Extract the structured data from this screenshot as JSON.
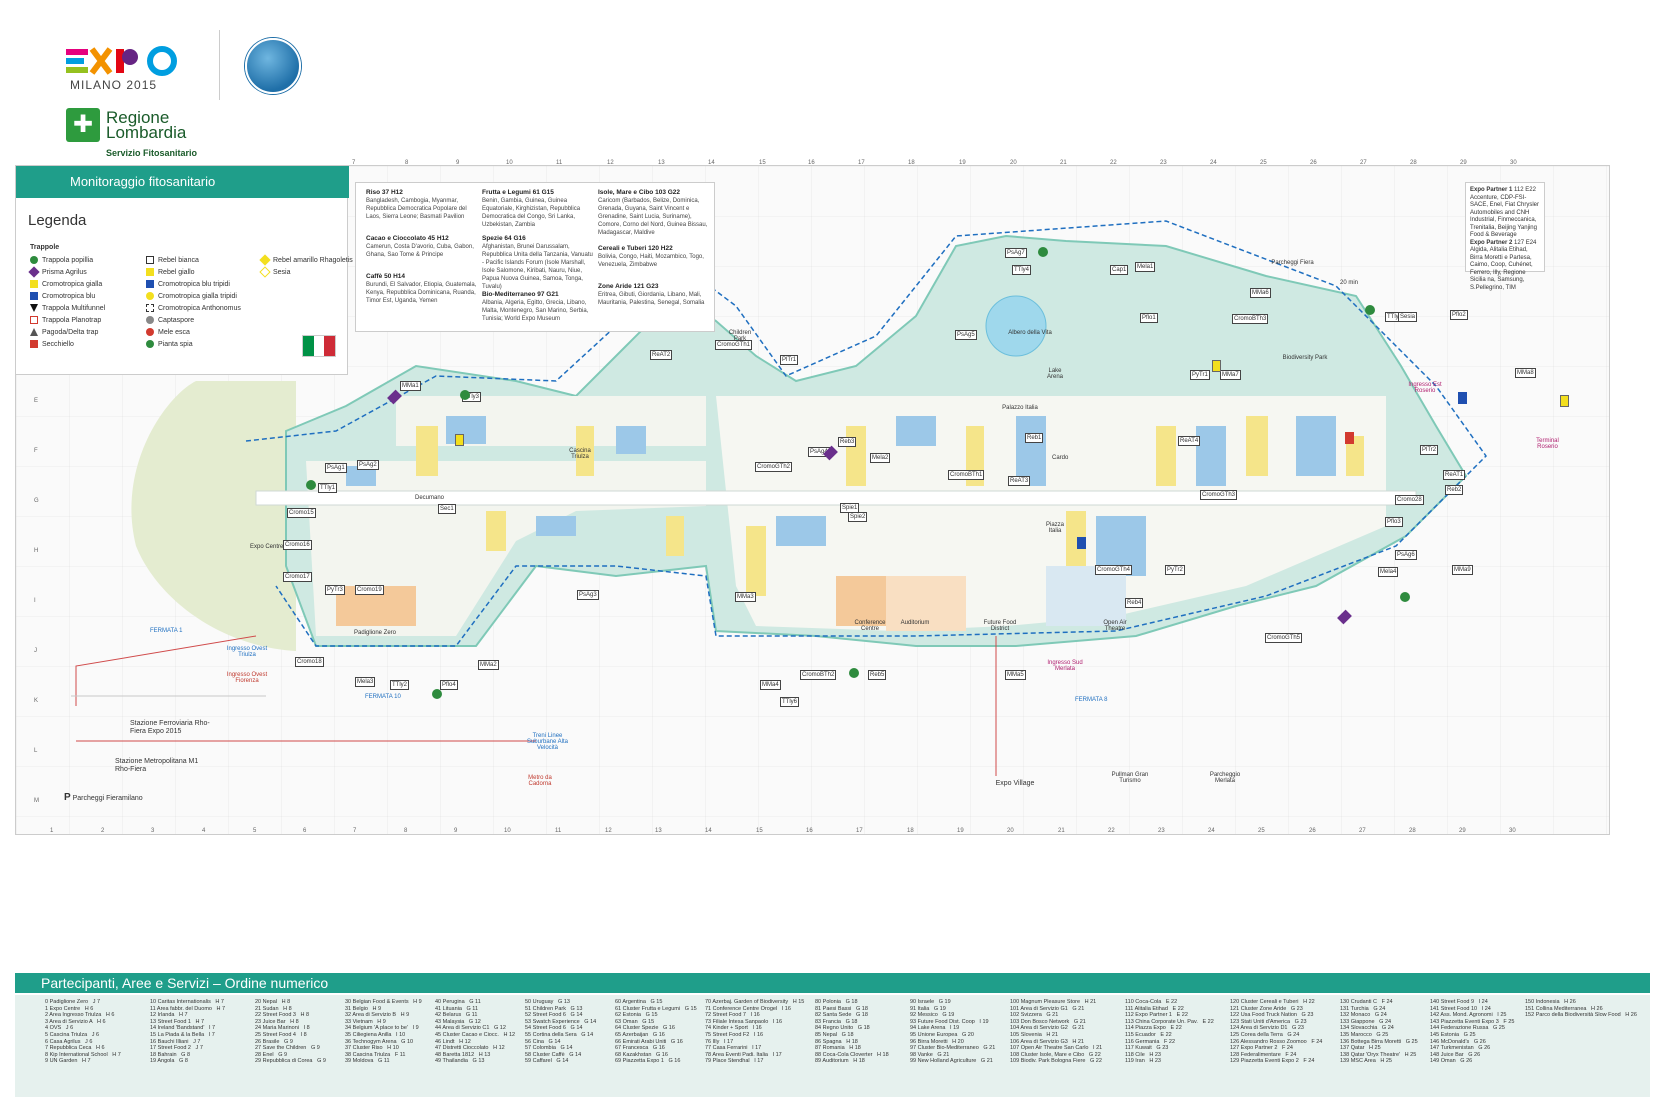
{
  "branding": {
    "expo_subtitle": "MILANO 2015",
    "region_name": "Regione Lombardia",
    "region_service": "Servizio Fitosanitario"
  },
  "legend": {
    "header": "Monitoraggio fitosanitario",
    "title": "Legenda",
    "traps_title": "Trappole",
    "items_col1": [
      "Trappola popillia",
      "Prisma Agrilus",
      "Cromotropica gialla",
      "Cromotropica blu",
      "Trappola Multifunnel",
      "Trappola Planotrap",
      "Pagoda/Delta trap",
      "Secchiello"
    ],
    "items_col2": [
      "Rebel bianca",
      "Rebel giallo",
      "Cromotropica blu tripidi",
      "Cromotropica gialla tripidi",
      "Cromotropica Anthonomus",
      "Captaspore",
      "Mele esca",
      "Pianta spia"
    ],
    "items_col3": [
      "Rebel amarillo Rhagoletis",
      "Sesia"
    ],
    "colors": {
      "teal": "#1f9e8a",
      "yellow": "#f3df1e",
      "blue": "#1f4fb0",
      "purple": "#6a2f8c",
      "red": "#d23a2f",
      "green": "#2e8b3e"
    }
  },
  "clusters": [
    {
      "name": "Riso",
      "grid": "37 H12",
      "members": "Bangladesh, Cambogia, Myanmar, Repubblica Democratica Popolare del Laos, Sierra Leone; Basmati Pavilion"
    },
    {
      "name": "Cacao e Cioccolato",
      "grid": "45 H12",
      "members": "Camerun, Costa D'avorio, Cuba, Gabon, Ghana, Sao Tome & Principe"
    },
    {
      "name": "Caffè",
      "grid": "50 H14",
      "members": "Burundi, El Salvador, Etiopia, Guatemala, Kenya, Repubblica Dominicana, Ruanda, Timor Est, Uganda, Yemen"
    },
    {
      "name": "Frutta e Legumi",
      "grid": "61 G15",
      "members": "Benin, Gambia, Guinea, Guinea Equatoriale, Kirghizistan, Repubblica Democratica del Congo, Sri Lanka, Uzbekistan, Zambia"
    },
    {
      "name": "Spezie",
      "grid": "64 G16",
      "members": "Afghanistan, Brunei Darussalam, Repubblica Unita della Tanzania, Vanuatu - Pacific Islands Forum (Isole Marshall, Isole Salomone, Kiribati, Nauru, Niue, Papua Nuova Guinea, Samoa, Tonga, Tuvalu)"
    },
    {
      "name": "Bio-Mediterraneo",
      "grid": "97 G21",
      "members": "Albania, Algeria, Egitto, Grecia, Libano, Malta, Montenegro, San Marino, Serbia, Tunisia; World Expo Museum"
    },
    {
      "name": "Isole, Mare e Cibo",
      "grid": "103 G22",
      "members": "Caricom (Barbados, Belize, Dominica, Grenada, Guyana, Saint Vincent e Grenadine, Saint Lucia, Suriname), Comore, Corno del Nord, Guinea Bissau, Madagascar, Maldive"
    },
    {
      "name": "Cereali e Tuberi",
      "grid": "120 H22",
      "members": "Bolivia, Congo, Haiti, Mozambico, Togo, Venezuela, Zimbabwe"
    },
    {
      "name": "Zone Aride",
      "grid": "121 G23",
      "members": "Eritrea, Gibuti, Giordania, Libano, Mali, Mauritania, Palestina, Senegal, Somalia"
    }
  ],
  "partners": [
    {
      "name": "Expo Partner 1",
      "grid": "112 E22",
      "members": "Accenture, CDP-FSI-SACE, Enel, Fiat Chrysler Automobiles and CNH Industrial, Finmeccanica, Trenitalia, Beijing Yanjing Food & Beverage"
    },
    {
      "name": "Expo Partner 2",
      "grid": "127 E24",
      "members": "Algida, Alitalia Etihad, Birra Moretti e Partesa, Caimo, Coop, Cuhénet, Ferrero, Illy, Regione Sicilia na, Samsung, S.Pellegrino, TIM"
    }
  ],
  "map": {
    "top_cols": [
      "7",
      "8",
      "9",
      "10",
      "11",
      "12",
      "13",
      "14",
      "15",
      "16",
      "17",
      "18",
      "19",
      "20",
      "21",
      "22",
      "23",
      "24",
      "25",
      "26",
      "27",
      "28",
      "29",
      "30"
    ],
    "bottom_cols": [
      "1",
      "2",
      "3",
      "4",
      "5",
      "6",
      "7",
      "8",
      "9",
      "10",
      "11",
      "12",
      "13",
      "14",
      "15",
      "16",
      "17",
      "18",
      "19",
      "20",
      "21",
      "22",
      "23",
      "24",
      "25",
      "26",
      "27",
      "28",
      "29",
      "30"
    ],
    "rows": [
      "E",
      "F",
      "G",
      "H",
      "I",
      "J",
      "K",
      "L",
      "M"
    ],
    "areas": [
      {
        "label": "Expo Centre"
      },
      {
        "label": "Padiglione Zero"
      },
      {
        "label": "Children Park"
      },
      {
        "label": "Cascina Triulza"
      },
      {
        "label": "Piazza Italia"
      },
      {
        "label": "Lake Arena"
      },
      {
        "label": "Albero della Vita"
      },
      {
        "label": "Palazzo Italia"
      },
      {
        "label": "Open Air Theatre"
      },
      {
        "label": "Auditorium"
      },
      {
        "label": "Future Food District"
      },
      {
        "label": "Conference Centre"
      },
      {
        "label": "Biodiversity Park"
      },
      {
        "label": "Expo Village"
      },
      {
        "label": "Stazione Ferroviaria Rho-Fiera Expo 2015"
      },
      {
        "label": "Stazione Metropolitana M1 Rho-Fiera"
      },
      {
        "label": "Parcheggi Fieramilano"
      },
      {
        "label": "Ingresso Ovest Triulza"
      },
      {
        "label": "Ingresso Ovest Fiorenza"
      },
      {
        "label": "Ingresso Sud Merlata"
      },
      {
        "label": "Ingresso Est Roserio"
      },
      {
        "label": "Terminal Roserio"
      },
      {
        "label": "FERMATA 1"
      },
      {
        "label": "FERMATA 8"
      },
      {
        "label": "FERMATA 10"
      },
      {
        "label": "Decumano"
      },
      {
        "label": "Cardo"
      },
      {
        "label": "Pullman Gran Turismo"
      },
      {
        "label": "Parcheggio Merlata"
      },
      {
        "label": "Metro da Cadorna"
      },
      {
        "label": "Treni Linee Suburbane Alta Velocità"
      },
      {
        "label": "Parcheggi Fiera"
      },
      {
        "label": "20 min"
      }
    ],
    "trap_labels": [
      "Cromo15",
      "Cromo16",
      "Cromo17",
      "Cromo18",
      "Cromo19",
      "PsAg1",
      "PsAg2",
      "PsAg3",
      "PsAg4",
      "PsAg5",
      "PsAg6",
      "PsAg7",
      "MMa1",
      "MMa2",
      "MMa3",
      "MMa4",
      "MMa5",
      "MMa6",
      "MMa7",
      "MMa8",
      "MMa9",
      "TTly1",
      "TTly2",
      "TTly3",
      "TTly4",
      "TTly5",
      "TTly6",
      "Reb1",
      "Reb2",
      "Reb3",
      "Reb4",
      "Reb5",
      "PlTr1",
      "PlTr2",
      "PyTr1",
      "PyTr2",
      "PyTr3",
      "Pflo1",
      "Pflo2",
      "Pflo3",
      "Pflo4",
      "Mela1",
      "Mela2",
      "Mela3",
      "Mela4",
      "Spie1",
      "Spie2",
      "Cromo28",
      "CromoGTh1",
      "CromoGTh2",
      "CromoGTh3",
      "CromoGTh4",
      "CromoGTh5",
      "CromoBTh1",
      "CromoBTh2",
      "CromoBTh3",
      "ReAT1",
      "ReAT2",
      "ReAT3",
      "ReAT4",
      "Sesia",
      "Sec1",
      "Cap1"
    ]
  },
  "index_title": "Partecipanti, Aree e Servizi – Ordine numerico",
  "index_cols": [
    "0 Padiglione Zero   J 7\n1 Expo Centre   H 6\n2 Area Ingresso Triulza   H 6\n3 Area di Servizio A   H 6\n4 OVS   J 6\n5 Cascina Triulza   J 6\n6 Casa Agrilus   J 6\n7 Repubblica Ceca   H 6\n8 Kip International School   H 7\n9 UN Garden   H 7",
    "10 Caritas Internationalis   H 7\n11 Area fabbr. del Duomo   H 7\n12 Irlanda   H 7\n13 Street Food 1   H 7\n14 Ireland 'Bandstand'   I 7\n15 La Piada & la Bella   I 7\n16 Bauchi Illiani   J 7\n17 Street Food 2   J 7\n18 Bahrain   G 8\n19 Angola   G 8",
    "20 Nepal   H 8\n21 Sudan   H 8\n22 Street Food 3   H 8\n23 Juice Bar   H 8\n24 Maria Marinoni   I 8\n25 Street Food 4   I 8\n26 Brasile   G 9\n27 Save the Children   G 9\n28 Enel   G 9\n29 Repubblica di Corea   G 9",
    "30 Belgian Food & Events   H 9\n31 Belgio   H 9\n32 Area di Servizio B   H 9\n33 Vietnam   H 9\n34 Belgium 'A place to be'   I 9\n35 Ciliegiena Anilla   I 10\n36 Technogym Arena   G 10\n37 Cluster Riso   H 10\n38 Cascina Triulza   F 11\n39 Moldova   G 11",
    "40 Perugina   G 11\n41 Lituania   G 11\n42 Belarus   G 11\n43 Malaysia   G 12\n44 Area di Servizio C1   G 12\n45 Cluster Cacao e Ciocc.   H 12\n46 Lindt   H 12\n47 Distretti Cioccolato   H 12\n48 Baretta 1812   H 13\n49 Thailandia   G 13",
    "50 Uruguay   G 13\n51 Children Park   G 13\n52 Street Food 6   G 14\n53 Swatch Experience   G 14\n54 Street Food 6   G 14\n55 Cortina della Sera   G 14\n56 Cina   G 14\n57 Colombia   G 14\n58 Cluster Caffè   G 14\n59 Caffarel   G 14",
    "60 Argentina   G 15\n61 Cluster Frutta e Legumi   G 15\n62 Estonia   G 15\n63 Oman   G 15\n64 Cluster Spezie   G 16\n65 Azerbaijan   G 16\n66 Emirati Arabi Uniti   G 16\n67 Francesca   G 16\n68 Kazakhstan   G 16\n69 Piazzetta Expo 1   G 16",
    "70 Azerbaj. Garden of Biodiversity   H 15\n71 Conference Centre Orogel   I 16\n72 Street Food 7   I 16\n73 Filiale Intesa Sanpaolo   I 16\n74 Kinder + Sport   I 16\n75 Street Food F2   I 16\n76 Illy   I 17\n77 Casa Ferrarini   I 17\n78 Area Eventi Padi. Italia   I 17\n79 Place Stendhal   I 17",
    "80 Polonia   G 18\n81 Paesi Bassi   G 18\n82 Santa Sede   G 18\n83 Francia   G 18\n84 Regno Unito   G 18\n85 Nepal   G 18\n86 Spagna   H 18\n87 Romania   H 18\n88 Coca-Cola Cloverter   H 18\n89 Auditorium   H 18",
    "90 Israele   G 19\n91 Italia   G 19\n92 Messico   G 19\n93 Future Food Dist. Coop   I 19\n94 Lake Arena   I 19\n95 Unione Europea   G 20\n96 Birra Moretti   H 20\n97 Cluster Bio-Mediterraneo   G 21\n98 Vanke   G 21\n99 New Holland Agriculture   G 21",
    "100 Magnum Pleasure Store   H 21\n101 Area di Servizio G1   G 21\n102 Svizzera   G 21\n103 Don Bosco Network   G 21\n104 Area di Servizio G2   G 21\n105 Slovenia   H 21\n106 Area di Servizio G3   H 21\n107 Open Air Theatre San Carlo   I 21\n108 Cluster Isole, Mare e Cibo   G 22\n109 Biodiv. Park Bologna Fiere   G 22",
    "110 Coca-Cola   E 22\n111 Alitalia Etihad   E 22\n112 Expo Partner 1   E 22\n113 China Corporate Un. Pav.   E 22\n114 Piazza Expo   E 22\n115 Ecuador   E 22\n116 Germania   F 22\n117 Kuwait   G 23\n118 Cile   H 23\n119 Iran   H 23",
    "120 Cluster Cereali e Tuberi   H 22\n121 Cluster Zone Aride   G 23\n122 Usa Food Truck Nation   G 23\n123 Stati Uniti d'America   G 23\n124 Area di Servizio D1   G 23\n125 Corea della Terra   G 24\n126 Alessandro Rosso Zoomoo   F 24\n127 Expo Partner 2   F 24\n128 Federalimentare   F 24\n129 Piazzetta Eventi Expo 2   F 24",
    "130 Crudanti C   F 24\n131 Turchia   G 24\n132 Monaco   G 24\n133 Giappone   G 24\n134 Slovacchia   G 24\n135 Marocco   G 25\n136 Bottega Birra Moretti   G 25\n137 Qatar   H 25\n138 Qatar 'Oryx Theatre'   H 25\n139 MSC Area   H 25",
    "140 Street Food 9   I 24\n141 Street Food 10   I 24\n142 Ass. Mond. Agronomi   I 25\n143 Piazzetta Eventi Expo 3   F 25\n144 Federazione Russa   G 25\n145 Estonia   G 25\n146 McDonald's   G 26\n147 Turkmenistan   G 26\n148 Juice Bar   G 26\n149 Oman   G 26",
    "150 Indonesia   H 26\n151 Collina Mediterranea   H 26\n152 Parco della Biodiversità Slow Food   H 26"
  ]
}
